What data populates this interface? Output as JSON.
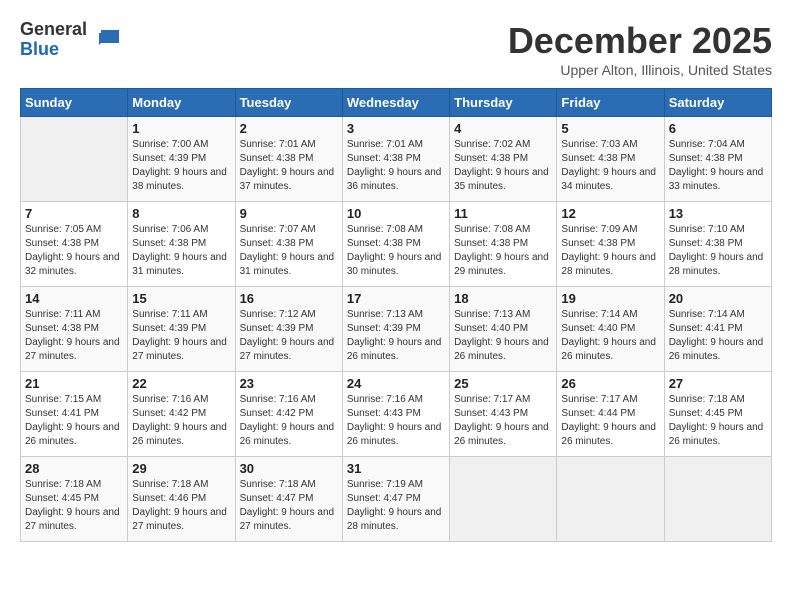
{
  "header": {
    "logo_general": "General",
    "logo_blue": "Blue",
    "month_title": "December 2025",
    "location": "Upper Alton, Illinois, United States"
  },
  "weekdays": [
    "Sunday",
    "Monday",
    "Tuesday",
    "Wednesday",
    "Thursday",
    "Friday",
    "Saturday"
  ],
  "weeks": [
    [
      {
        "day": "",
        "sunrise": "",
        "sunset": "",
        "daylight": ""
      },
      {
        "day": "1",
        "sunrise": "Sunrise: 7:00 AM",
        "sunset": "Sunset: 4:39 PM",
        "daylight": "Daylight: 9 hours and 38 minutes."
      },
      {
        "day": "2",
        "sunrise": "Sunrise: 7:01 AM",
        "sunset": "Sunset: 4:38 PM",
        "daylight": "Daylight: 9 hours and 37 minutes."
      },
      {
        "day": "3",
        "sunrise": "Sunrise: 7:01 AM",
        "sunset": "Sunset: 4:38 PM",
        "daylight": "Daylight: 9 hours and 36 minutes."
      },
      {
        "day": "4",
        "sunrise": "Sunrise: 7:02 AM",
        "sunset": "Sunset: 4:38 PM",
        "daylight": "Daylight: 9 hours and 35 minutes."
      },
      {
        "day": "5",
        "sunrise": "Sunrise: 7:03 AM",
        "sunset": "Sunset: 4:38 PM",
        "daylight": "Daylight: 9 hours and 34 minutes."
      },
      {
        "day": "6",
        "sunrise": "Sunrise: 7:04 AM",
        "sunset": "Sunset: 4:38 PM",
        "daylight": "Daylight: 9 hours and 33 minutes."
      }
    ],
    [
      {
        "day": "7",
        "sunrise": "Sunrise: 7:05 AM",
        "sunset": "Sunset: 4:38 PM",
        "daylight": "Daylight: 9 hours and 32 minutes."
      },
      {
        "day": "8",
        "sunrise": "Sunrise: 7:06 AM",
        "sunset": "Sunset: 4:38 PM",
        "daylight": "Daylight: 9 hours and 31 minutes."
      },
      {
        "day": "9",
        "sunrise": "Sunrise: 7:07 AM",
        "sunset": "Sunset: 4:38 PM",
        "daylight": "Daylight: 9 hours and 31 minutes."
      },
      {
        "day": "10",
        "sunrise": "Sunrise: 7:08 AM",
        "sunset": "Sunset: 4:38 PM",
        "daylight": "Daylight: 9 hours and 30 minutes."
      },
      {
        "day": "11",
        "sunrise": "Sunrise: 7:08 AM",
        "sunset": "Sunset: 4:38 PM",
        "daylight": "Daylight: 9 hours and 29 minutes."
      },
      {
        "day": "12",
        "sunrise": "Sunrise: 7:09 AM",
        "sunset": "Sunset: 4:38 PM",
        "daylight": "Daylight: 9 hours and 28 minutes."
      },
      {
        "day": "13",
        "sunrise": "Sunrise: 7:10 AM",
        "sunset": "Sunset: 4:38 PM",
        "daylight": "Daylight: 9 hours and 28 minutes."
      }
    ],
    [
      {
        "day": "14",
        "sunrise": "Sunrise: 7:11 AM",
        "sunset": "Sunset: 4:38 PM",
        "daylight": "Daylight: 9 hours and 27 minutes."
      },
      {
        "day": "15",
        "sunrise": "Sunrise: 7:11 AM",
        "sunset": "Sunset: 4:39 PM",
        "daylight": "Daylight: 9 hours and 27 minutes."
      },
      {
        "day": "16",
        "sunrise": "Sunrise: 7:12 AM",
        "sunset": "Sunset: 4:39 PM",
        "daylight": "Daylight: 9 hours and 27 minutes."
      },
      {
        "day": "17",
        "sunrise": "Sunrise: 7:13 AM",
        "sunset": "Sunset: 4:39 PM",
        "daylight": "Daylight: 9 hours and 26 minutes."
      },
      {
        "day": "18",
        "sunrise": "Sunrise: 7:13 AM",
        "sunset": "Sunset: 4:40 PM",
        "daylight": "Daylight: 9 hours and 26 minutes."
      },
      {
        "day": "19",
        "sunrise": "Sunrise: 7:14 AM",
        "sunset": "Sunset: 4:40 PM",
        "daylight": "Daylight: 9 hours and 26 minutes."
      },
      {
        "day": "20",
        "sunrise": "Sunrise: 7:14 AM",
        "sunset": "Sunset: 4:41 PM",
        "daylight": "Daylight: 9 hours and 26 minutes."
      }
    ],
    [
      {
        "day": "21",
        "sunrise": "Sunrise: 7:15 AM",
        "sunset": "Sunset: 4:41 PM",
        "daylight": "Daylight: 9 hours and 26 minutes."
      },
      {
        "day": "22",
        "sunrise": "Sunrise: 7:16 AM",
        "sunset": "Sunset: 4:42 PM",
        "daylight": "Daylight: 9 hours and 26 minutes."
      },
      {
        "day": "23",
        "sunrise": "Sunrise: 7:16 AM",
        "sunset": "Sunset: 4:42 PM",
        "daylight": "Daylight: 9 hours and 26 minutes."
      },
      {
        "day": "24",
        "sunrise": "Sunrise: 7:16 AM",
        "sunset": "Sunset: 4:43 PM",
        "daylight": "Daylight: 9 hours and 26 minutes."
      },
      {
        "day": "25",
        "sunrise": "Sunrise: 7:17 AM",
        "sunset": "Sunset: 4:43 PM",
        "daylight": "Daylight: 9 hours and 26 minutes."
      },
      {
        "day": "26",
        "sunrise": "Sunrise: 7:17 AM",
        "sunset": "Sunset: 4:44 PM",
        "daylight": "Daylight: 9 hours and 26 minutes."
      },
      {
        "day": "27",
        "sunrise": "Sunrise: 7:18 AM",
        "sunset": "Sunset: 4:45 PM",
        "daylight": "Daylight: 9 hours and 26 minutes."
      }
    ],
    [
      {
        "day": "28",
        "sunrise": "Sunrise: 7:18 AM",
        "sunset": "Sunset: 4:45 PM",
        "daylight": "Daylight: 9 hours and 27 minutes."
      },
      {
        "day": "29",
        "sunrise": "Sunrise: 7:18 AM",
        "sunset": "Sunset: 4:46 PM",
        "daylight": "Daylight: 9 hours and 27 minutes."
      },
      {
        "day": "30",
        "sunrise": "Sunrise: 7:18 AM",
        "sunset": "Sunset: 4:47 PM",
        "daylight": "Daylight: 9 hours and 27 minutes."
      },
      {
        "day": "31",
        "sunrise": "Sunrise: 7:19 AM",
        "sunset": "Sunset: 4:47 PM",
        "daylight": "Daylight: 9 hours and 28 minutes."
      },
      {
        "day": "",
        "sunrise": "",
        "sunset": "",
        "daylight": ""
      },
      {
        "day": "",
        "sunrise": "",
        "sunset": "",
        "daylight": ""
      },
      {
        "day": "",
        "sunrise": "",
        "sunset": "",
        "daylight": ""
      }
    ]
  ]
}
